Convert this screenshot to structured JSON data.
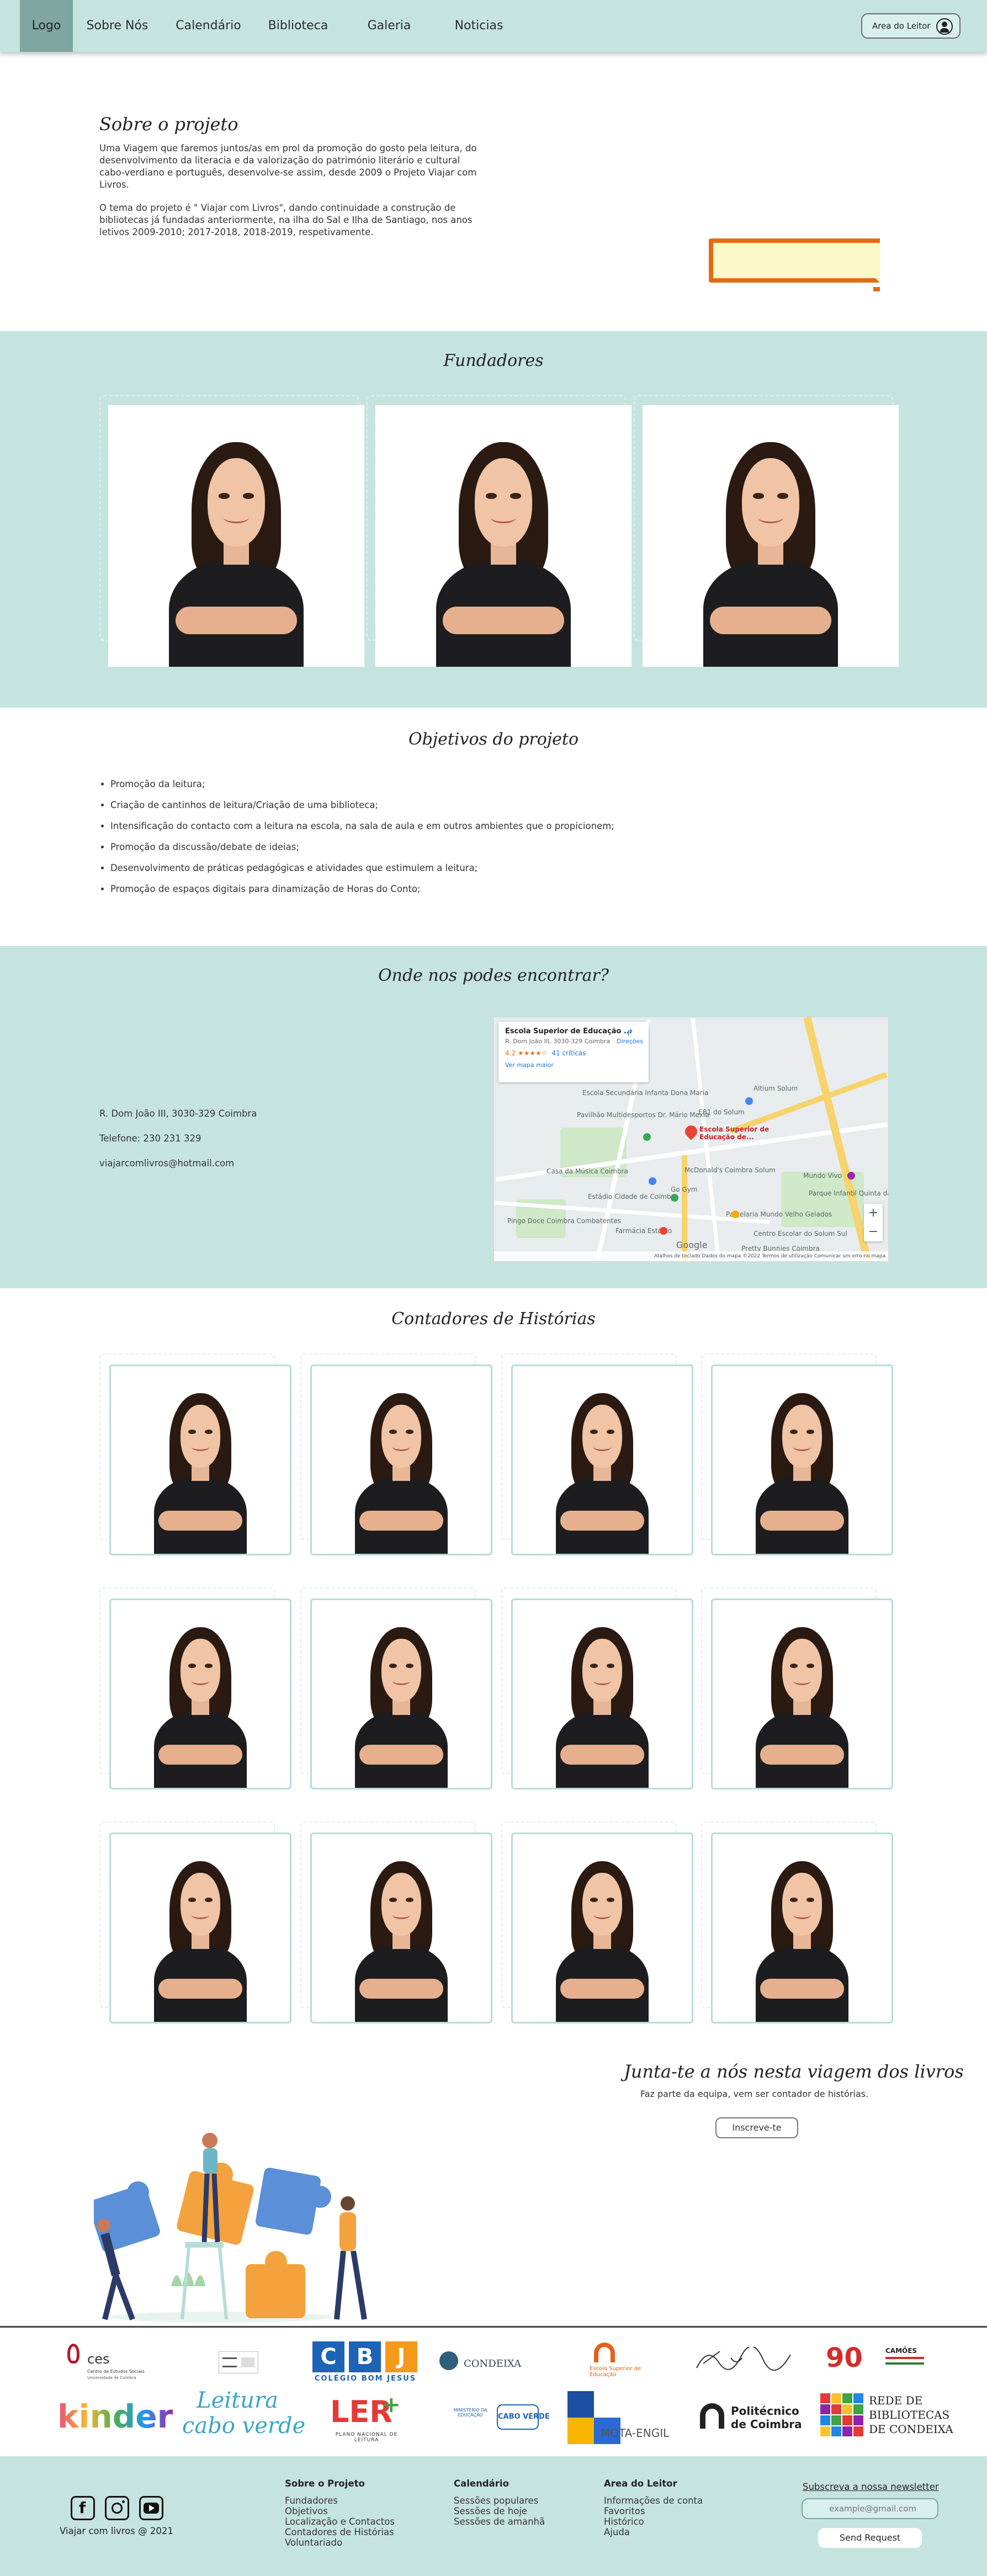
{
  "nav": {
    "items": [
      {
        "label": "Logo",
        "active": true
      },
      {
        "label": "Sobre Nós"
      },
      {
        "label": "Calendário"
      },
      {
        "label": "Biblioteca"
      },
      {
        "label": "Galeria"
      },
      {
        "label": "Noticias"
      }
    ],
    "reader_button": "Area do Leitor",
    "reader_icon": "user-circle-icon"
  },
  "about": {
    "title": "Sobre o projeto",
    "paragraph1": "Uma Viagem que faremos juntos/as em prol da promoção do gosto pela leitura, do desenvolvimento da literacia e da valorização do património literário e cultural cabo-verdiano e português, desenvolve-se assim, desde 2009 o Projeto Viajar com Livros.",
    "paragraph2": "O tema do projeto é \" Viajar com Livros\", dando continuidade a construção de bibliotecas já fundadas anteriormente, na ilha do Sal e Ilha de Santiago, nos anos letivos 2009-2010; 2017-2018, 2018-2019, respetivamente."
  },
  "founders": {
    "title": "Fundadores"
  },
  "objectives": {
    "title": "Objetivos do projeto",
    "items": [
      "Promoção da leitura;",
      "Criação de cantinhos de leitura/Criação de uma biblioteca;",
      "Intensificação do contacto com a leitura na escola, na sala de aula e em outros ambientes que o propicionem;",
      "Promoção da discussão/debate de ideias;",
      "Desenvolvimento de práticas pedagógicas e atividades que estimulem a leitura;",
      "Promoção de espaços digitais para dinamização de Horas do Conto;"
    ]
  },
  "location": {
    "title": "Onde nos podes encontrar?",
    "address": "R. Dom João III, 3030-329 Coimbra",
    "phone": "Telefone:  230 231 329",
    "email": "viajarcomlivros@hotmail.com",
    "map": {
      "place_name": "Escola Superior de Educação ...",
      "place_address": "R. Dom João III, 3030-329 Coimbra",
      "rating": "4.2 ★★★★☆",
      "reviews": "41 críticas",
      "larger_map": "Ver mapa maior",
      "directions": "Direções",
      "pin_label": "Escola Superior de Educação de...",
      "labels": [
        "Escola Secundária Infanta Dona Maria",
        "Pavilhão Multidesportos Dr. Mário Mexia",
        "Casa da Música Coimbra",
        "Estádio Cidade de Coimbra",
        "EB1 do Solum",
        "Altium Solum",
        "McDonald's Coimbra Solum",
        "Pastelaria Mundo Velho Gelados",
        "Farmácia Estádio",
        "Pingo Doce Coimbra Combatentes",
        "Mundo Vivo",
        "Parque Infantil Quinta da Lomba",
        "Centro Escolar do Solum Sul",
        "Pretty Bunnies Coimbra",
        "Go Gym"
      ],
      "footer": "Atalhos de teclado   Dados do mapa ©2022   Termos de utilização   Comunicar um erro no mapa",
      "google": "Google"
    }
  },
  "storytellers": {
    "title": "Contadores de Histórias"
  },
  "join": {
    "title": "Junta-te a nós nesta viagem dos livros",
    "subtitle": "Faz parte da equipa, vem ser contador de histórias.",
    "button": "Inscreve-te"
  },
  "partners": {
    "logos": [
      "ces",
      "Centro de Estudos Sociais",
      "Universidade de Coimbra",
      "C",
      "B",
      "J",
      "COLÉGIO BOM JESUS",
      "CONDEIXA",
      "Escola Superior de Educação",
      "90",
      "CAMÕES",
      "kinder",
      "Leitura",
      "cabo verde",
      "LER",
      "PLANO NACIONAL DE LEITURA",
      "MINISTÉRIO DA EDUCAÇÃO",
      "CABO VERDE",
      "MOTA-ENGIL",
      "Politécnico",
      "de Coimbra",
      "REDE DE",
      "BIBLIOTECAS",
      "DE CONDEIXA"
    ]
  },
  "footer": {
    "copyright": "Viajar com livros @ 2021",
    "social_icons": [
      "facebook-icon",
      "instagram-icon",
      "youtube-icon"
    ],
    "columns": [
      {
        "heading": "Sobre o Projeto",
        "items": [
          "Fundadores",
          "Objetivos",
          "Localização e Contactos",
          "Contadores de Histórias",
          "Voluntariado"
        ]
      },
      {
        "heading": "Calendário",
        "items": [
          "Sessões populares",
          "Sessões de hoje",
          "Sessões de amanhã"
        ]
      },
      {
        "heading": "Area do Leitor",
        "items": [
          "Informações de conta",
          "Favoritos",
          "Histórico",
          "Ajuda"
        ]
      }
    ],
    "newsletter_title": "Subscreva a nossa newsletter",
    "newsletter_placeholder": "example@gmail.com",
    "newsletter_button": "Send Request"
  },
  "colors": {
    "band": "#c6e4df",
    "nav_active": "#7fa6a0",
    "accent_orange": "#e46b14",
    "card_border": "#b7dcd6"
  }
}
